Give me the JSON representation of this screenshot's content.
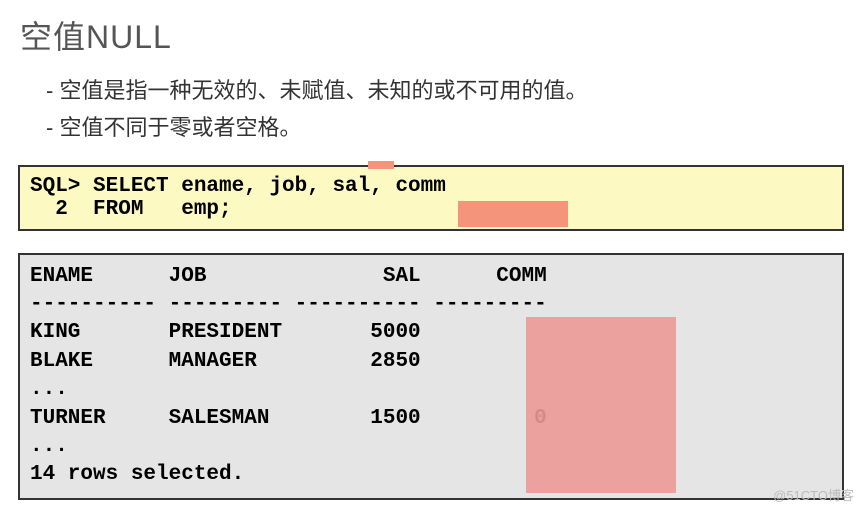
{
  "title": "空值NULL",
  "bullets": [
    "空值是指一种无效的、未赋值、未知的或不可用的值。",
    "空值不同于零或者空格。"
  ],
  "sql": {
    "line1": "SQL> SELECT ename, job, sal, comm",
    "line2": "  2  FROM   emp;"
  },
  "output": {
    "header": "ENAME      JOB              SAL      COMM",
    "separator": "---------- --------- ---------- ---------",
    "rows": [
      "KING       PRESIDENT       5000",
      "BLAKE      MANAGER         2850",
      "...",
      "TURNER     SALESMAN        1500         0",
      "..."
    ],
    "footer": "14 rows selected."
  },
  "chart_data": {
    "type": "table",
    "title": "空值NULL",
    "columns": [
      "ENAME",
      "JOB",
      "SAL",
      "COMM"
    ],
    "rows": [
      {
        "ENAME": "KING",
        "JOB": "PRESIDENT",
        "SAL": 5000,
        "COMM": null
      },
      {
        "ENAME": "BLAKE",
        "JOB": "MANAGER",
        "SAL": 2850,
        "COMM": null
      },
      {
        "ENAME": "TURNER",
        "JOB": "SALESMAN",
        "SAL": 1500,
        "COMM": 0
      }
    ],
    "row_count_reported": 14,
    "query": "SELECT ename, job, sal, comm FROM emp;"
  },
  "watermark": "@51CTO博客"
}
